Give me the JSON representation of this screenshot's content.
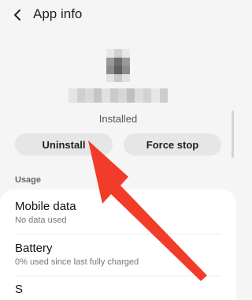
{
  "appbar": {
    "title": "App info",
    "back_icon": "chevron-left-icon"
  },
  "app": {
    "icon": "blurred-app-icon",
    "status": "Installed"
  },
  "actions": {
    "uninstall_label": "Uninstall",
    "force_stop_label": "Force stop"
  },
  "usage": {
    "section_label": "Usage",
    "items": [
      {
        "title": "Mobile data",
        "subtitle": "No data used"
      },
      {
        "title": "Battery",
        "subtitle": "0% used since last fully charged"
      },
      {
        "title": "S",
        "subtitle": ""
      }
    ]
  },
  "annotation": {
    "color": "#f03c28"
  }
}
